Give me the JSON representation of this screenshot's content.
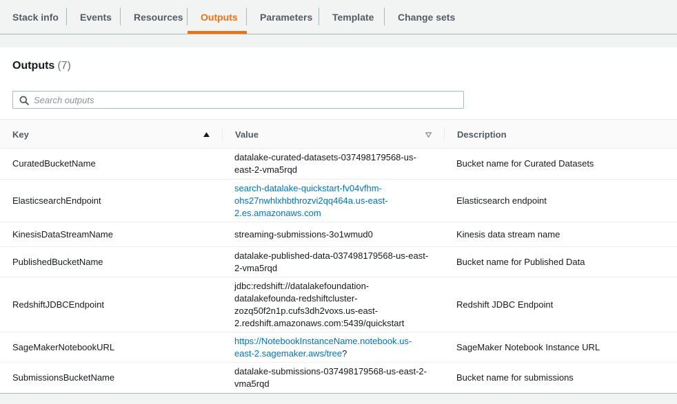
{
  "tabs": [
    {
      "label": "Stack info"
    },
    {
      "label": "Events"
    },
    {
      "label": "Resources"
    },
    {
      "label": "Outputs"
    },
    {
      "label": "Parameters"
    },
    {
      "label": "Template"
    },
    {
      "label": "Change sets"
    }
  ],
  "active_tab": "Outputs",
  "panel": {
    "title": "Outputs",
    "count": "(7)"
  },
  "search": {
    "placeholder": "Search outputs",
    "value": ""
  },
  "columns": {
    "key": "Key",
    "value": "Value",
    "description": "Description"
  },
  "rows": [
    {
      "key": "CuratedBucketName",
      "value_lines": [
        "datalake-curated-datasets-037498179568-us-",
        "east-2-vma5rqd"
      ],
      "link": false,
      "description": "Bucket name for Curated Datasets"
    },
    {
      "key": "ElasticsearchEndpoint",
      "value_lines": [
        "search-datalake-quickstart-fv04vfhm-",
        "ohs27nwhlxhbthrozvi2qq464a.us-east-",
        "2.es.amazonaws.com"
      ],
      "link": true,
      "description": "Elasticsearch endpoint"
    },
    {
      "key": "KinesisDataStreamName",
      "value_lines": [
        "streaming-submissions-3o1wmud0"
      ],
      "link": false,
      "description": "Kinesis data stream name"
    },
    {
      "key": "PublishedBucketName",
      "value_lines": [
        "datalake-published-data-037498179568-us-east-",
        "2-vma5rqd"
      ],
      "link": false,
      "description": "Bucket name for Published Data"
    },
    {
      "key": "RedshiftJDBCEndpoint",
      "value_lines": [
        "jdbc:redshift://datalakefoundation-",
        "datalakefounda-redshiftcluster-",
        "zozq50f2n1p.cufs3dh2voxs.us-east-",
        "2.redshift.amazonaws.com:5439/quickstart"
      ],
      "link": false,
      "description": "Redshift JDBC Endpoint"
    },
    {
      "key": "SageMakerNotebookURL",
      "value_lines": [
        "https://NotebookInstanceName.notebook.us-",
        "east-2.sagemaker.aws/tree"
      ],
      "value_suffix": "?",
      "link": true,
      "description": "SageMaker Notebook Instance URL"
    },
    {
      "key": "SubmissionsBucketName",
      "value_lines": [
        "datalake-submissions-037498179568-us-east-2-",
        "vma5rqd"
      ],
      "link": false,
      "description": "Bucket name for submissions"
    }
  ],
  "icons": {
    "search": "search-icon",
    "sort_key": "sort-ascending-icon",
    "sort_value": "sort-descending-outline-icon"
  },
  "colors": {
    "accent": "#ec7211",
    "link": "#0073bb"
  }
}
